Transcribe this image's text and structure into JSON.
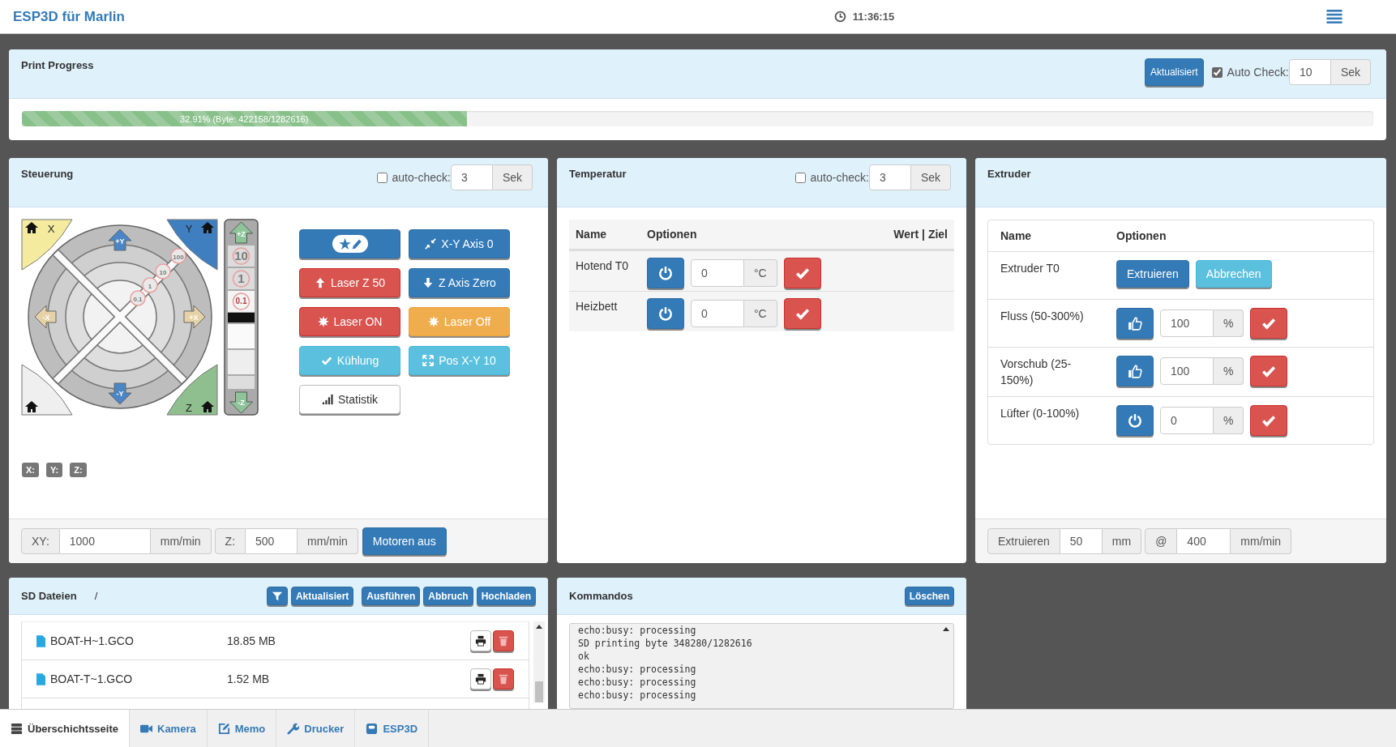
{
  "navbar": {
    "title": "ESP3D für Marlin",
    "time": "11:36:15"
  },
  "print_progress": {
    "title": "Print Progress",
    "refresh_button": "Aktualisiert",
    "auto_check": {
      "label": "Auto Check:",
      "checked": true,
      "value": "10",
      "unit": "Sek"
    },
    "progress": {
      "level": 0.3291,
      "text": "32.91% (Byte: 422158/1282616)"
    }
  },
  "control": {
    "title": "Steuerung",
    "auto_check": {
      "label": "auto-check:",
      "checked": false,
      "value": "3",
      "unit": "Sek"
    },
    "jog": {
      "corners": [
        {
          "kind": "x",
          "label": "X"
        },
        {
          "kind": "y",
          "label": "Y"
        },
        {
          "kind": "all"
        },
        {
          "kind": "z",
          "label": "Z"
        }
      ],
      "arrows": [
        "+Y",
        "-X",
        "+X",
        "-Y"
      ],
      "z_arrows": [
        "+Z",
        "-Z"
      ],
      "z_steps": [
        "10",
        "1",
        "0.1"
      ],
      "xy_steps": [
        "0.1",
        "1",
        "10",
        "100"
      ]
    },
    "buttons": [
      {
        "kind": "primary"
      },
      {
        "kind": "primary",
        "label": "X-Y Axis 0"
      },
      {
        "kind": "danger",
        "label": "Laser Z 50"
      },
      {
        "kind": "primary",
        "label": "Z Axis Zero"
      },
      {
        "kind": "danger",
        "label": "Laser ON"
      },
      {
        "kind": "warning",
        "label": "Laser Off"
      },
      {
        "kind": "info",
        "label": "Kühlung"
      },
      {
        "kind": "info",
        "label": "Pos X-Y 10"
      },
      {
        "kind": "default",
        "label": "Statistik"
      }
    ],
    "positions": [
      "X:",
      "Y:",
      "Z:"
    ],
    "footer": {
      "xy_label": "XY:",
      "xy_value": "1000",
      "xy_unit": "mm/min",
      "z_label": "Z:",
      "z_value": "500",
      "z_unit": "mm/min",
      "motors_button": "Motoren aus"
    }
  },
  "temperature": {
    "title": "Temperatur",
    "auto_check": {
      "label": "auto-check:",
      "checked": false,
      "value": "3",
      "unit": "Sek"
    },
    "columns": [
      "Name",
      "Optionen",
      "Wert | Ziel"
    ],
    "rows": [
      {
        "name": "Hotend T0",
        "value": "0",
        "unit": "°C"
      },
      {
        "name": "Heizbett",
        "value": "0",
        "unit": "°C"
      }
    ]
  },
  "extruder": {
    "title": "Extruder",
    "columns": [
      "Name",
      "Optionen"
    ],
    "rows": [
      {
        "kind": "extrude",
        "name": "Extruder T0",
        "buttons": [
          "Extruieren",
          "Abbrechen"
        ]
      },
      {
        "kind": "setting",
        "name": "Fluss (50-300%)",
        "value": "100",
        "unit": "%"
      },
      {
        "kind": "setting",
        "name": "Vorschub (25-150%)",
        "value": "100",
        "unit": "%"
      },
      {
        "kind": "fan",
        "name": "Lüfter (0-100%)",
        "value": "0",
        "unit": "%"
      }
    ],
    "footer": {
      "label": "Extruieren",
      "distance": "50",
      "distance_unit": "mm",
      "at": "@",
      "speed": "400",
      "speed_unit": "mm/min"
    }
  },
  "sd_files": {
    "title": "SD Dateien",
    "path": "/",
    "buttons": [
      "Aktualisiert",
      "Ausführen",
      "Abbruch",
      "Hochladen"
    ],
    "files": [
      {
        "name": "BOAT-H~1.GCO",
        "size": "18.85 MB"
      },
      {
        "name": "BOAT-T~1.GCO",
        "size": "1.52 MB"
      }
    ]
  },
  "commands": {
    "title": "Kommandos",
    "clear_button": "Löschen",
    "log": [
      "echo:busy: processing",
      "SD printing byte 348280/1282616",
      "ok",
      "echo:busy: processing",
      "echo:busy: processing",
      "echo:busy: processing"
    ]
  },
  "tabs": [
    {
      "label": "Überschichtsseite",
      "selected": true
    },
    {
      "label": "Kamera",
      "selected": false
    },
    {
      "label": "Memo",
      "selected": false
    },
    {
      "label": "Drucker",
      "selected": false
    },
    {
      "label": "ESP3D",
      "selected": false
    }
  ]
}
